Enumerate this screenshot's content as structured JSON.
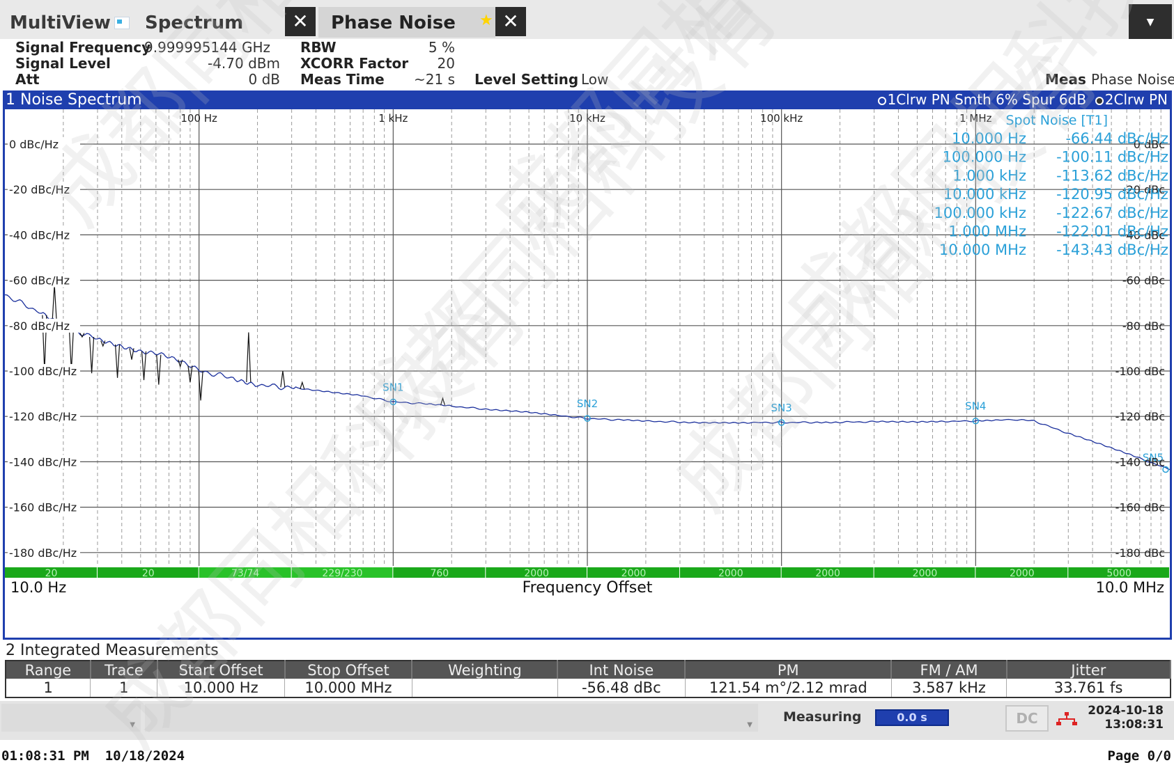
{
  "tabs": {
    "multiview": "MultiView",
    "spectrum": "Spectrum",
    "phase_noise": "Phase Noise",
    "close_glyph": "✕"
  },
  "settings": {
    "signal_frequency_label": "Signal Frequency",
    "signal_frequency_value": "9.999995144 GHz",
    "signal_level_label": "Signal Level",
    "signal_level_value": "-4.70 dBm",
    "att_label": "Att",
    "att_value": "0 dB",
    "rbw_label": "RBW",
    "rbw_value": "5 %",
    "xcorr_label": "XCORR Factor",
    "xcorr_value": "20",
    "meas_time_label": "Meas Time",
    "meas_time_value": "~21 s",
    "level_setting_label": "Level Setting",
    "level_setting_value": "Low",
    "meas_label": "Meas",
    "meas_value": "Phase Noise"
  },
  "window1": {
    "title": "1 Noise Spectrum",
    "trace1": "1Clrw PN Smth 6% Spur 6dB",
    "trace2": "2Clrw PN"
  },
  "chart_data": {
    "type": "line",
    "x_scale": "log",
    "xlim": [
      10,
      10000000
    ],
    "ylim": [
      -200,
      10
    ],
    "x_tick_labels": [
      "100 Hz",
      "1 kHz",
      "10 kHz",
      "100 kHz",
      "1 MHz"
    ],
    "x_ticks": [
      100,
      1000,
      10000,
      100000,
      1000000
    ],
    "y_ticks_left": [
      0,
      -20,
      -40,
      -60,
      -80,
      -100,
      -120,
      -140,
      -160,
      -180
    ],
    "y_tick_labels_left": [
      "0 dBc/Hz",
      "-20 dBc/Hz",
      "-40 dBc/Hz",
      "-60 dBc/Hz",
      "-80 dBc/Hz",
      "-100 dBc/Hz",
      "-120 dBc/Hz",
      "-140 dBc/Hz",
      "-160 dBc/Hz",
      "-180 dBc/Hz"
    ],
    "y_ticks_right": [
      0,
      -20,
      -40,
      -60,
      -80,
      -100,
      -120,
      -140,
      -160,
      -180
    ],
    "y_tick_labels_right": [
      "0 dBc",
      "-20 dBc",
      "-40 dBc",
      "-60 dBc",
      "-80 dBc",
      "-100 dBc",
      "-120 dBc",
      "-140 dBc",
      "-160 dBc",
      "-180 dBc"
    ],
    "x_start_label": "10.0 Hz",
    "x_stop_label": "10.0 MHz",
    "xlabel": "Frequency Offset",
    "grid": true,
    "series": [
      {
        "color": "#1a2f9c",
        "x": [
          10,
          15,
          20,
          30,
          50,
          80,
          100,
          150,
          200,
          300,
          500,
          700,
          1000,
          1500,
          2000,
          3000,
          5000,
          7000,
          10000,
          15000,
          20000,
          30000,
          50000,
          70000,
          100000,
          150000,
          200000,
          300000,
          500000,
          700000,
          1000000,
          1300000,
          1600000,
          2000000,
          3000000,
          5000000,
          7000000,
          10000000
        ],
        "y": [
          -66.4,
          -74,
          -80,
          -86,
          -91,
          -95,
          -100,
          -103,
          -106,
          -107.5,
          -109.5,
          -111,
          -113.6,
          -114.5,
          -115.5,
          -116.8,
          -118.3,
          -119.6,
          -120.9,
          -121.6,
          -122.1,
          -122.5,
          -122.7,
          -122.7,
          -122.7,
          -122.6,
          -122.5,
          -122.4,
          -122.3,
          -122.2,
          -122.0,
          -121.5,
          -121.5,
          -122.0,
          -127.5,
          -134.0,
          -138.5,
          -143.4
        ]
      }
    ],
    "spurs": [
      {
        "x": 16,
        "y": -100
      },
      {
        "x": 18,
        "y": -62
      },
      {
        "x": 22,
        "y": -100
      },
      {
        "x": 25,
        "y": -85
      },
      {
        "x": 28,
        "y": -101
      },
      {
        "x": 32,
        "y": -89
      },
      {
        "x": 38,
        "y": -103
      },
      {
        "x": 45,
        "y": -95
      },
      {
        "x": 52,
        "y": -104
      },
      {
        "x": 62,
        "y": -106
      },
      {
        "x": 80,
        "y": -98
      },
      {
        "x": 90,
        "y": -105
      },
      {
        "x": 102,
        "y": -113
      },
      {
        "x": 180,
        "y": -83
      },
      {
        "x": 270,
        "y": -100
      },
      {
        "x": 340,
        "y": -105
      },
      {
        "x": 1800,
        "y": -112
      }
    ],
    "markers": [
      {
        "label": "SN1",
        "x": 1000,
        "y": -113.6
      },
      {
        "label": "SN2",
        "x": 10000,
        "y": -120.9
      },
      {
        "label": "SN3",
        "x": 100000,
        "y": -122.7
      },
      {
        "label": "SN4",
        "x": 1000000,
        "y": -122.0
      },
      {
        "label": "SN5",
        "x": 10000000,
        "y": -143.4
      }
    ],
    "spot_noise_title": "Spot Noise [T1]",
    "spot_noise": [
      {
        "freq": "10.000 Hz",
        "value": "-66.44 dBc/Hz"
      },
      {
        "freq": "100.000 Hz",
        "value": "-100.11 dBc/Hz"
      },
      {
        "freq": "1.000 kHz",
        "value": "-113.62 dBc/Hz"
      },
      {
        "freq": "10.000 kHz",
        "value": "-120.95 dBc/Hz"
      },
      {
        "freq": "100.000 kHz",
        "value": "-122.67 dBc/Hz"
      },
      {
        "freq": "1.000 MHz",
        "value": "-122.01 dBc/Hz"
      },
      {
        "freq": "10.000 MHz",
        "value": "-143.43 dBc/Hz"
      }
    ],
    "xcorr_segments": [
      {
        "label": "20",
        "x_start": 10,
        "x_end": 30
      },
      {
        "label": "20",
        "x_start": 30,
        "x_end": 100
      },
      {
        "label": "73/74",
        "x_start": 100,
        "x_end": 300
      },
      {
        "label": "229/230",
        "x_start": 300,
        "x_end": 1000
      },
      {
        "label": "760",
        "x_start": 1000,
        "x_end": 3000
      },
      {
        "label": "2000",
        "x_start": 3000,
        "x_end": 10000
      },
      {
        "label": "2000",
        "x_start": 10000,
        "x_end": 30000
      },
      {
        "label": "2000",
        "x_start": 30000,
        "x_end": 100000
      },
      {
        "label": "2000",
        "x_start": 100000,
        "x_end": 300000
      },
      {
        "label": "2000",
        "x_start": 300000,
        "x_end": 1000000
      },
      {
        "label": "2000",
        "x_start": 1000000,
        "x_end": 3000000
      },
      {
        "label": "5000",
        "x_start": 3000000,
        "x_end": 10000000
      }
    ]
  },
  "window2": {
    "title": "2 Integrated Measurements",
    "columns": [
      "Range",
      "Trace",
      "Start Offset",
      "Stop Offset",
      "Weighting",
      "Int Noise",
      "PM",
      "FM / AM",
      "Jitter"
    ],
    "rows": [
      [
        "1",
        "1",
        "10.000 Hz",
        "10.000 MHz",
        "",
        "-56.48 dBc",
        "121.54 m°/2.12 mrad",
        "3.587 kHz",
        "33.761 fs"
      ]
    ]
  },
  "statusbar": {
    "measuring": "Measuring",
    "progress": "0.0 s",
    "dc": "DC",
    "date": "2024-10-18",
    "time": "13:08:31"
  },
  "footer": {
    "timestamp": "01:08:31 PM  10/18/2024",
    "page": "Page 0/0"
  },
  "watermark_text": "成都同相科技有"
}
